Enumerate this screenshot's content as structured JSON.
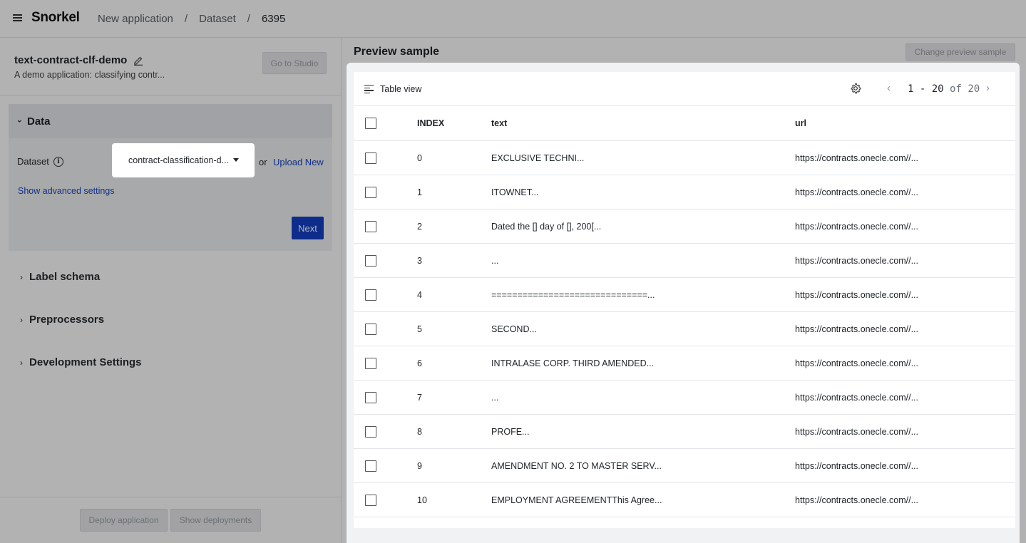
{
  "topbar": {
    "logo": "Snorkel",
    "breadcrumbs": [
      "New application",
      "Dataset",
      "6395"
    ]
  },
  "app": {
    "title": "text-contract-clf-demo",
    "description": "A demo application: classifying contr...",
    "go_studio": "Go to Studio"
  },
  "data_section": {
    "title": "Data",
    "dataset_label": "Dataset",
    "dataset_value": "contract-classification-d...",
    "or": "or",
    "upload_new": "Upload New",
    "advanced": "Show advanced settings",
    "next": "Next"
  },
  "sections": [
    "Label schema",
    "Preprocessors",
    "Development Settings"
  ],
  "footer": {
    "deploy": "Deploy application",
    "show_deployments": "Show deployments"
  },
  "preview": {
    "title": "Preview sample",
    "change": "Change preview sample",
    "view_label": "Table view",
    "pager": {
      "range": "1 - 20",
      "of": "of",
      "total": "20"
    },
    "columns": [
      "INDEX",
      "text",
      "url"
    ],
    "rows": [
      {
        "index": "0",
        "text": "EXCLUSIVE TECHNI...",
        "url": "https://contracts.onecle.com//..."
      },
      {
        "index": "1",
        "text": "ITOWNET...",
        "url": "https://contracts.onecle.com//..."
      },
      {
        "index": "2",
        "text": "Dated the [] day of [], 200[...",
        "url": "https://contracts.onecle.com//..."
      },
      {
        "index": "3",
        "text": "...",
        "url": "https://contracts.onecle.com//..."
      },
      {
        "index": "4",
        "text": "==============================...",
        "url": "https://contracts.onecle.com//..."
      },
      {
        "index": "5",
        "text": "SECOND...",
        "url": "https://contracts.onecle.com//..."
      },
      {
        "index": "6",
        "text": "INTRALASE CORP. THIRD AMENDED...",
        "url": "https://contracts.onecle.com//..."
      },
      {
        "index": "7",
        "text": "...",
        "url": "https://contracts.onecle.com//..."
      },
      {
        "index": "8",
        "text": "PROFE...",
        "url": "https://contracts.onecle.com//..."
      },
      {
        "index": "9",
        "text": "AMENDMENT NO. 2 TO MASTER SERV...",
        "url": "https://contracts.onecle.com//..."
      },
      {
        "index": "10",
        "text": "EMPLOYMENT AGREEMENTThis Agree...",
        "url": "https://contracts.onecle.com//..."
      }
    ]
  }
}
